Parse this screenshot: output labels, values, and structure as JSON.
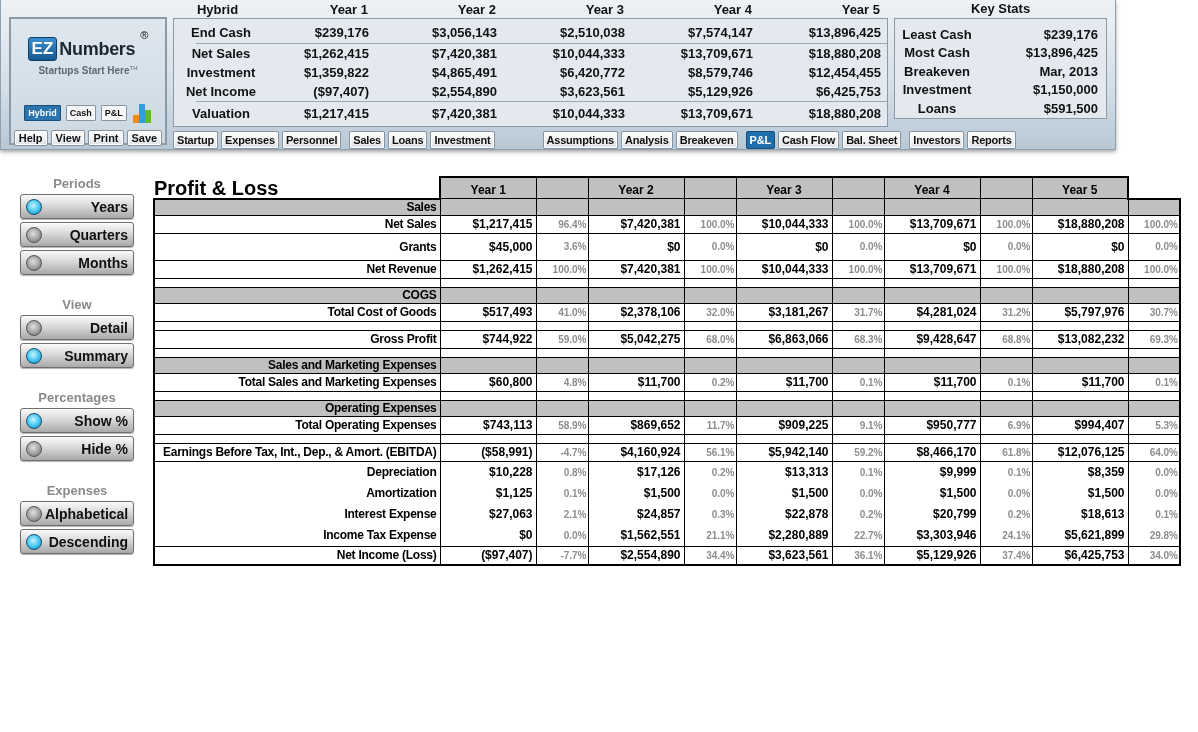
{
  "logo": {
    "mark": "EZ",
    "name": "Numbers",
    "registered": "®",
    "tagline": "Startups Start Here",
    "trademark": "TH"
  },
  "view_modes": [
    {
      "label": "Hybrid",
      "selected": true
    },
    {
      "label": "Cash",
      "selected": false
    },
    {
      "label": "P&L",
      "selected": false
    }
  ],
  "file_buttons": [
    "Help",
    "View",
    "Print",
    "Save"
  ],
  "summary": {
    "title": "Hybrid",
    "columns": [
      "Year 1",
      "Year 2",
      "Year 3",
      "Year 4",
      "Year 5"
    ],
    "groups": [
      [
        {
          "label": "End Cash",
          "values": [
            "$239,176",
            "$3,056,143",
            "$2,510,038",
            "$7,574,147",
            "$13,896,425"
          ]
        }
      ],
      [
        {
          "label": "Net Sales",
          "values": [
            "$1,262,415",
            "$7,420,381",
            "$10,044,333",
            "$13,709,671",
            "$18,880,208"
          ]
        },
        {
          "label": "Investment",
          "values": [
            "$1,359,822",
            "$4,865,491",
            "$6,420,772",
            "$8,579,746",
            "$12,454,455"
          ]
        },
        {
          "label": "Net Income",
          "values": [
            "($97,407)",
            "$2,554,890",
            "$3,623,561",
            "$5,129,926",
            "$6,425,753"
          ]
        }
      ],
      [
        {
          "label": "Valuation",
          "values": [
            "$1,217,415",
            "$7,420,381",
            "$10,044,333",
            "$13,709,671",
            "$18,880,208"
          ]
        }
      ]
    ]
  },
  "key_stats": {
    "title": "Key Stats",
    "rows": [
      {
        "label": "Least Cash",
        "value": "$239,176"
      },
      {
        "label": "Most Cash",
        "value": "$13,896,425"
      },
      {
        "label": "Breakeven",
        "value": "Mar, 2013"
      },
      {
        "label": "Investment",
        "value": "$1,150,000"
      },
      {
        "label": "Loans",
        "value": "$591,500"
      }
    ]
  },
  "nav_groups": [
    [
      {
        "label": "Startup",
        "selected": false
      },
      {
        "label": "Expenses",
        "selected": false
      },
      {
        "label": "Personnel",
        "selected": false
      }
    ],
    [
      {
        "label": "Sales",
        "selected": false
      },
      {
        "label": "Loans",
        "selected": false
      },
      {
        "label": "Investment",
        "selected": false
      }
    ],
    [
      {
        "label": "Assumptions",
        "selected": false
      },
      {
        "label": "Analysis",
        "selected": false
      },
      {
        "label": "Breakeven",
        "selected": false
      }
    ],
    [
      {
        "label": "P&L",
        "selected": true
      },
      {
        "label": "Cash Flow",
        "selected": false
      },
      {
        "label": "Bal. Sheet",
        "selected": false
      }
    ],
    [
      {
        "label": "Investors",
        "selected": false
      },
      {
        "label": "Reports",
        "selected": false
      }
    ]
  ],
  "sidebar": [
    {
      "title": "Periods",
      "options": [
        {
          "label": "Years",
          "selected": true
        },
        {
          "label": "Quarters",
          "selected": false
        },
        {
          "label": "Months",
          "selected": false
        }
      ]
    },
    {
      "title": "View",
      "options": [
        {
          "label": "Detail",
          "selected": false
        },
        {
          "label": "Summary",
          "selected": true
        }
      ]
    },
    {
      "title": "Percentages",
      "options": [
        {
          "label": "Show %",
          "selected": true
        },
        {
          "label": "Hide %",
          "selected": false
        }
      ]
    },
    {
      "title": "Expenses",
      "options": [
        {
          "label": "Alphabetical",
          "selected": false
        },
        {
          "label": "Descending",
          "selected": true
        }
      ]
    }
  ],
  "report": {
    "title": "Profit & Loss",
    "columns": [
      "Year 1",
      "Year 2",
      "Year 3",
      "Year 4",
      "Year 5"
    ],
    "rows": [
      {
        "kind": "section",
        "label": "Sales"
      },
      {
        "kind": "line",
        "label": "Net Sales",
        "cells": [
          [
            "$1,217,415",
            "96.4%"
          ],
          [
            "$7,420,381",
            "100.0%"
          ],
          [
            "$10,044,333",
            "100.0%"
          ],
          [
            "$13,709,671",
            "100.0%"
          ],
          [
            "$18,880,208",
            "100.0%"
          ]
        ]
      },
      {
        "kind": "tall",
        "label": "Grants",
        "cells": [
          [
            "$45,000",
            "3.6%"
          ],
          [
            "$0",
            "0.0%"
          ],
          [
            "$0",
            "0.0%"
          ],
          [
            "$0",
            "0.0%"
          ],
          [
            "$0",
            "0.0%"
          ]
        ]
      },
      {
        "kind": "line",
        "label": "Net Revenue",
        "cells": [
          [
            "$1,262,415",
            "100.0%"
          ],
          [
            "$7,420,381",
            "100.0%"
          ],
          [
            "$10,044,333",
            "100.0%"
          ],
          [
            "$13,709,671",
            "100.0%"
          ],
          [
            "$18,880,208",
            "100.0%"
          ]
        ]
      },
      {
        "kind": "spacer"
      },
      {
        "kind": "section",
        "label": "COGS"
      },
      {
        "kind": "line",
        "label": "Total Cost of Goods",
        "cells": [
          [
            "$517,493",
            "41.0%"
          ],
          [
            "$2,378,106",
            "32.0%"
          ],
          [
            "$3,181,267",
            "31.7%"
          ],
          [
            "$4,281,024",
            "31.2%"
          ],
          [
            "$5,797,976",
            "30.7%"
          ]
        ]
      },
      {
        "kind": "spacer"
      },
      {
        "kind": "line",
        "label": "Gross Profit",
        "cells": [
          [
            "$744,922",
            "59.0%"
          ],
          [
            "$5,042,275",
            "68.0%"
          ],
          [
            "$6,863,066",
            "68.3%"
          ],
          [
            "$9,428,647",
            "68.8%"
          ],
          [
            "$13,082,232",
            "69.3%"
          ]
        ]
      },
      {
        "kind": "spacer"
      },
      {
        "kind": "section",
        "label": "Sales and Marketing Expenses"
      },
      {
        "kind": "line",
        "label": "Total Sales and Marketing Expenses",
        "cells": [
          [
            "$60,800",
            "4.8%"
          ],
          [
            "$11,700",
            "0.2%"
          ],
          [
            "$11,700",
            "0.1%"
          ],
          [
            "$11,700",
            "0.1%"
          ],
          [
            "$11,700",
            "0.1%"
          ]
        ]
      },
      {
        "kind": "spacer"
      },
      {
        "kind": "section",
        "label": "Operating Expenses"
      },
      {
        "kind": "line",
        "label": "Total Operating Expenses",
        "cells": [
          [
            "$743,113",
            "58.9%"
          ],
          [
            "$869,652",
            "11.7%"
          ],
          [
            "$909,225",
            "9.1%"
          ],
          [
            "$950,777",
            "6.9%"
          ],
          [
            "$994,407",
            "5.3%"
          ]
        ]
      },
      {
        "kind": "spacer"
      },
      {
        "kind": "line",
        "label": "Earnings Before Tax, Int., Dep., & Amort. (EBITDA)",
        "cells": [
          [
            "($58,991)",
            "-4.7%"
          ],
          [
            "$4,160,924",
            "56.1%"
          ],
          [
            "$5,942,140",
            "59.2%"
          ],
          [
            "$8,466,170",
            "61.8%"
          ],
          [
            "$12,076,125",
            "64.0%"
          ]
        ]
      },
      {
        "kind": "detail",
        "label": "Depreciation",
        "cells": [
          [
            "$10,228",
            "0.8%"
          ],
          [
            "$17,126",
            "0.2%"
          ],
          [
            "$13,313",
            "0.1%"
          ],
          [
            "$9,999",
            "0.1%"
          ],
          [
            "$8,359",
            "0.0%"
          ]
        ]
      },
      {
        "kind": "detail",
        "label": "Amortization",
        "cells": [
          [
            "$1,125",
            "0.1%"
          ],
          [
            "$1,500",
            "0.0%"
          ],
          [
            "$1,500",
            "0.0%"
          ],
          [
            "$1,500",
            "0.0%"
          ],
          [
            "$1,500",
            "0.0%"
          ]
        ]
      },
      {
        "kind": "detail",
        "label": "Interest Expense",
        "cells": [
          [
            "$27,063",
            "2.1%"
          ],
          [
            "$24,857",
            "0.3%"
          ],
          [
            "$22,878",
            "0.2%"
          ],
          [
            "$20,799",
            "0.2%"
          ],
          [
            "$18,613",
            "0.1%"
          ]
        ]
      },
      {
        "kind": "detail",
        "label": "Income Tax Expense",
        "cells": [
          [
            "$0",
            "0.0%"
          ],
          [
            "$1,562,551",
            "21.1%"
          ],
          [
            "$2,280,889",
            "22.7%"
          ],
          [
            "$3,303,946",
            "24.1%"
          ],
          [
            "$5,621,899",
            "29.8%"
          ]
        ]
      },
      {
        "kind": "line",
        "label": "Net Income (Loss)",
        "cells": [
          [
            "($97,407)",
            "-7.7%"
          ],
          [
            "$2,554,890",
            "34.4%"
          ],
          [
            "$3,623,561",
            "36.1%"
          ],
          [
            "$5,129,926",
            "37.4%"
          ],
          [
            "$6,425,753",
            "34.0%"
          ]
        ]
      }
    ]
  }
}
